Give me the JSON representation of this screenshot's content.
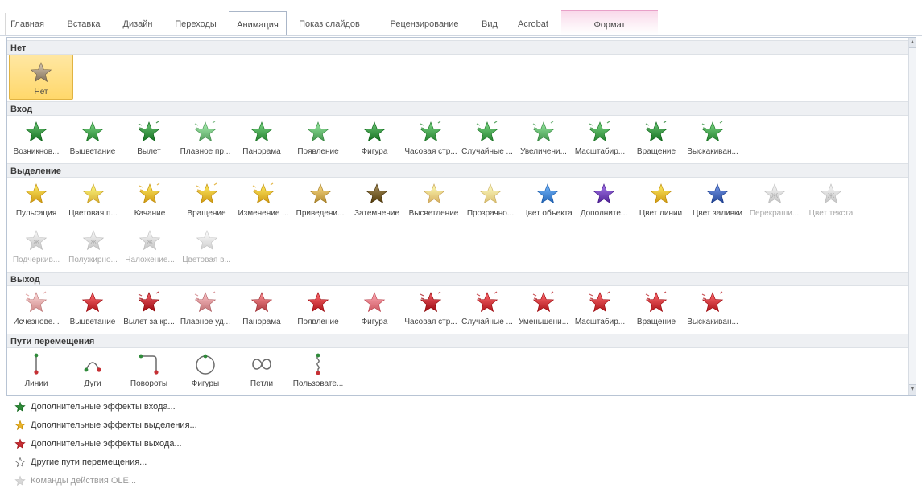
{
  "ribbon": {
    "tabs": [
      {
        "label": "Главная",
        "state": "normal"
      },
      {
        "label": "Вставка",
        "state": "normal"
      },
      {
        "label": "Дизайн",
        "state": "normal"
      },
      {
        "label": "Переходы",
        "state": "normal"
      },
      {
        "label": "Анимация",
        "state": "active"
      },
      {
        "label": "Показ слайдов",
        "state": "normal"
      },
      {
        "label": "Рецензирование",
        "state": "normal"
      },
      {
        "label": "Вид",
        "state": "normal"
      },
      {
        "label": "Acrobat",
        "state": "normal"
      },
      {
        "label": "Формат",
        "state": "context"
      }
    ]
  },
  "gallery": {
    "sections": [
      {
        "title": "Нет",
        "items": [
          {
            "label": "Нет",
            "icon": "star-none-icon",
            "color": "#9a8a74",
            "selected": true
          }
        ]
      },
      {
        "title": "Вход",
        "items": [
          {
            "label": "Возникнов...",
            "icon": "star-appear-icon",
            "color": "#2f8a3a"
          },
          {
            "label": "Выцветание",
            "icon": "star-fade-icon",
            "color": "#3f9b49"
          },
          {
            "label": "Вылет",
            "icon": "star-fly-in-icon",
            "color": "#2f8a3a"
          },
          {
            "label": "Плавное пр...",
            "icon": "star-float-in-icon",
            "color": "#6fb878"
          },
          {
            "label": "Панорама",
            "icon": "star-split-icon",
            "color": "#3f9b49"
          },
          {
            "label": "Появление",
            "icon": "star-wipe-icon",
            "color": "#5cae66"
          },
          {
            "label": "Фигура",
            "icon": "star-shape-icon",
            "color": "#2f8a3a"
          },
          {
            "label": "Часовая стр...",
            "icon": "star-wheel-icon",
            "color": "#3f9b49"
          },
          {
            "label": "Случайные ...",
            "icon": "star-random-bars-icon",
            "color": "#3f9b49"
          },
          {
            "label": "Увеличени...",
            "icon": "star-grow-turn-icon",
            "color": "#5cae66"
          },
          {
            "label": "Масштабир...",
            "icon": "star-zoom-icon",
            "color": "#3f9b49"
          },
          {
            "label": "Вращение",
            "icon": "star-swivel-icon",
            "color": "#2f8a3a"
          },
          {
            "label": "Выскакиван...",
            "icon": "star-bounce-icon",
            "color": "#3f9b49"
          }
        ]
      },
      {
        "title": "Выделение",
        "items": [
          {
            "label": "Пульсация",
            "icon": "star-pulse-icon",
            "color": "#e8b22a"
          },
          {
            "label": "Цветовая п...",
            "icon": "star-color-pulse-icon",
            "color": "#f0c64a"
          },
          {
            "label": "Качание",
            "icon": "star-teeter-icon",
            "color": "#e8b22a"
          },
          {
            "label": "Вращение",
            "icon": "star-spin-icon",
            "color": "#e8b22a"
          },
          {
            "label": "Изменение ...",
            "icon": "star-grow-shrink-icon",
            "color": "#e8b22a"
          },
          {
            "label": "Приведени...",
            "icon": "star-desaturate-icon",
            "color": "#c9a24a"
          },
          {
            "label": "Затемнение",
            "icon": "star-darken-icon",
            "color": "#6b5420"
          },
          {
            "label": "Высветление",
            "icon": "star-lighten-icon",
            "color": "#f0c87a"
          },
          {
            "label": "Прозрачно...",
            "icon": "star-transparency-icon",
            "color": "#f5d98a"
          },
          {
            "label": "Цвет объекта",
            "icon": "star-object-color-icon",
            "color": "#3d7fd0"
          },
          {
            "label": "Дополните...",
            "icon": "star-complementary-color-icon",
            "color": "#6a3db0"
          },
          {
            "label": "Цвет линии",
            "icon": "star-line-color-icon",
            "color": "#e8b22a"
          },
          {
            "label": "Цвет заливки",
            "icon": "star-fill-color-icon",
            "color": "#3d5fb0"
          },
          {
            "label": "Перекраши...",
            "icon": "star-brush-color-icon",
            "color": "#b8b8b8",
            "disabled": true
          },
          {
            "label": "Цвет текста",
            "icon": "star-font-color-icon",
            "color": "#b8b8b8",
            "disabled": true
          },
          {
            "label": "Подчеркив...",
            "icon": "star-underline-icon",
            "color": "#b8b8b8",
            "disabled": true
          },
          {
            "label": "Полужирно...",
            "icon": "star-bold-flash-icon",
            "color": "#b8b8b8",
            "disabled": true
          },
          {
            "label": "Наложение...",
            "icon": "star-bold-reveal-icon",
            "color": "#b8b8b8",
            "disabled": true
          },
          {
            "label": "Цветовая в...",
            "icon": "star-wave-icon",
            "color": "#c8c8c8",
            "disabled": true
          }
        ]
      },
      {
        "title": "Выход",
        "items": [
          {
            "label": "Исчезнове...",
            "icon": "star-disappear-icon",
            "color": "#e6a0a0"
          },
          {
            "label": "Выцветание",
            "icon": "star-fade-out-icon",
            "color": "#c62f34"
          },
          {
            "label": "Вылет за кр...",
            "icon": "star-fly-out-icon",
            "color": "#b5222a"
          },
          {
            "label": "Плавное уд...",
            "icon": "star-float-out-icon",
            "color": "#d98a8e"
          },
          {
            "label": "Панорама",
            "icon": "star-split-out-icon",
            "color": "#c6555a"
          },
          {
            "label": "Появление",
            "icon": "star-wipe-out-icon",
            "color": "#c62f34"
          },
          {
            "label": "Фигура",
            "icon": "star-shape-out-icon",
            "color": "#e6707a"
          },
          {
            "label": "Часовая стр...",
            "icon": "star-wheel-out-icon",
            "color": "#b5222a"
          },
          {
            "label": "Случайные ...",
            "icon": "star-random-bars-out-icon",
            "color": "#c62f34"
          },
          {
            "label": "Уменьшени...",
            "icon": "star-shrink-turn-icon",
            "color": "#c62f34"
          },
          {
            "label": "Масштабир...",
            "icon": "star-zoom-out-icon",
            "color": "#c62f34"
          },
          {
            "label": "Вращение",
            "icon": "star-swivel-out-icon",
            "color": "#c62f34"
          },
          {
            "label": "Выскакиван...",
            "icon": "star-bounce-out-icon",
            "color": "#c62f34"
          }
        ]
      },
      {
        "title": "Пути перемещения",
        "items": [
          {
            "label": "Линии",
            "icon": "path-lines-icon",
            "color": "#c62f34"
          },
          {
            "label": "Дуги",
            "icon": "path-arcs-icon",
            "color": "#c62f34"
          },
          {
            "label": "Повороты",
            "icon": "path-turns-icon",
            "color": "#c62f34"
          },
          {
            "label": "Фигуры",
            "icon": "path-shapes-icon",
            "color": "#2f8a3a"
          },
          {
            "label": "Петли",
            "icon": "path-loops-icon",
            "color": "#555555"
          },
          {
            "label": "Пользовате...",
            "icon": "path-custom-icon",
            "color": "#2f8a3a"
          }
        ]
      }
    ]
  },
  "menu": {
    "items": [
      {
        "label": "Дополнительные эффекты входа...",
        "icon": "entrance-effects-icon",
        "color": "#2f8a3a"
      },
      {
        "label": "Дополнительные эффекты выделения...",
        "icon": "emphasis-effects-icon",
        "color": "#e8b22a"
      },
      {
        "label": "Дополнительные эффекты выхода...",
        "icon": "exit-effects-icon",
        "color": "#c62f34"
      },
      {
        "label": "Другие пути перемещения...",
        "icon": "motion-paths-icon",
        "color": "#ffffff"
      },
      {
        "label": "Команды действия OLE...",
        "icon": "ole-action-icon",
        "color": "#aaaaaa",
        "disabled": true
      }
    ]
  }
}
